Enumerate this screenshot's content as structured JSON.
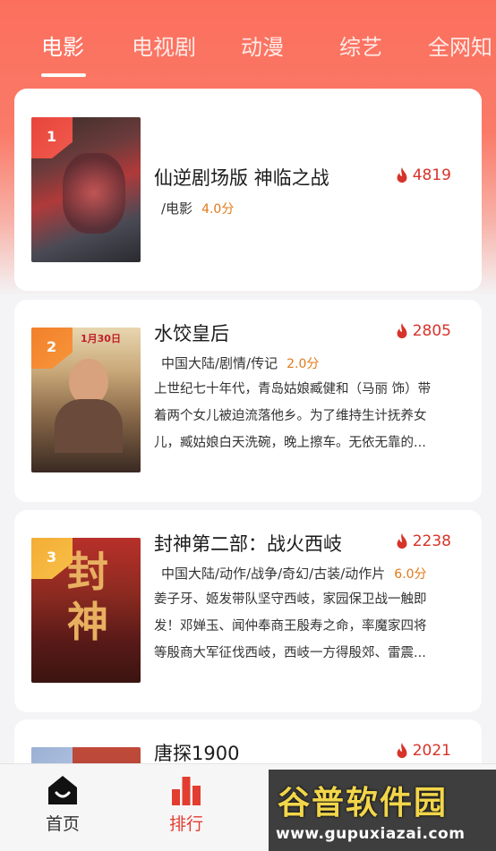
{
  "tabs": [
    {
      "label": "电影",
      "active": true
    },
    {
      "label": "电视剧",
      "active": false
    },
    {
      "label": "动漫",
      "active": false
    },
    {
      "label": "综艺",
      "active": false
    },
    {
      "label": "全网知",
      "active": false
    }
  ],
  "items": [
    {
      "rank": "1",
      "title": "仙逆剧场版 神临之战",
      "meta": "/电影",
      "score": "4.0分",
      "hot": "4819",
      "desc": []
    },
    {
      "rank": "2",
      "title": "水饺皇后",
      "meta": "中国大陆/剧情/传记",
      "score": "2.0分",
      "hot": "2805",
      "desc": [
        "上世纪七十年代，青岛姑娘臧健和（马丽 饰）带",
        "着两个女儿被迫流落他乡。为了维持生计抚养女",
        "儿，臧姑娘白天洗碗，晚上擦车。无依无靠的..."
      ]
    },
    {
      "rank": "3",
      "title": "封神第二部：战火西岐",
      "meta": "中国大陆/动作/战争/奇幻/古装/动作片",
      "score": "6.0分",
      "hot": "2238",
      "desc": [
        "姜子牙、姬发带队坚守西岐，家园保卫战一触即",
        "发！邓婵玉、闻仲奉商王殷寿之命，率魔家四将",
        "等殷商大军征伐西岐，西岐一方得殷郊、雷震..."
      ]
    },
    {
      "rank": "",
      "title": "唐探1900",
      "meta": "",
      "score": "",
      "hot": "2021",
      "desc": []
    }
  ],
  "bottom_nav": [
    {
      "label": "首页",
      "icon": "home-icon",
      "active": false
    },
    {
      "label": "排行",
      "icon": "ranking-icon",
      "active": true
    }
  ],
  "watermark": {
    "main": "谷普软件园",
    "url": "www.gupuxiazai.com"
  },
  "colors": {
    "accent": "#e23d30",
    "hot": "#d6332a",
    "score": "#e07a1a"
  }
}
